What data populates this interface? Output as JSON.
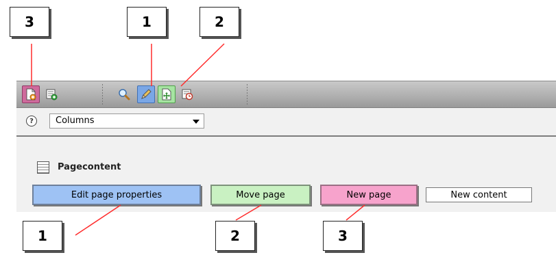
{
  "callouts": {
    "top_left": "3",
    "top_mid": "1",
    "top_right": "2",
    "bottom_left": "1",
    "bottom_mid": "2",
    "bottom_right": "3"
  },
  "toolbar": {
    "icons": [
      "new-page-icon",
      "new-content-icon",
      "search-icon",
      "pencil-icon",
      "move-page-icon",
      "history-icon"
    ]
  },
  "columns": {
    "help": "?",
    "selected": "Columns"
  },
  "content": {
    "title": "Pagecontent",
    "buttons": {
      "edit": "Edit page properties",
      "move": "Move page",
      "new_page": "New page",
      "new_content": "New content"
    }
  },
  "colors": {
    "annotation_line": "#ff2b2b",
    "edit_blue": "#9ec2f4",
    "move_green": "#c9f1c2",
    "new_pink": "#f7a3cc"
  }
}
